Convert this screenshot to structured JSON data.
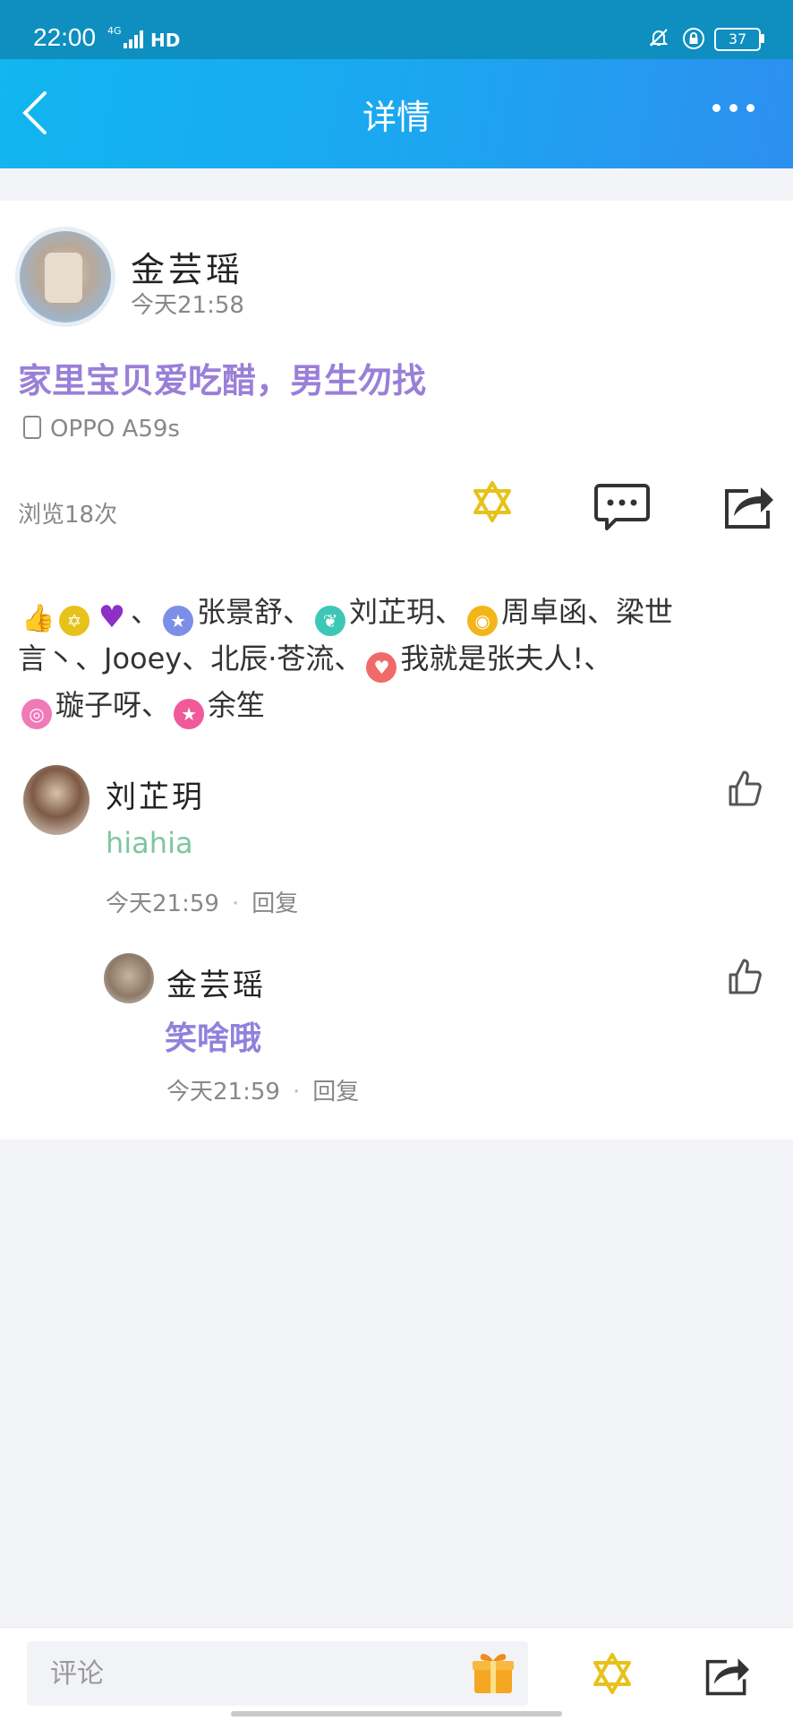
{
  "status_bar": {
    "time": "22:00",
    "network": "4G",
    "hd": "HD",
    "battery": "37"
  },
  "header": {
    "title": "详情"
  },
  "post": {
    "author": "金芸瑶",
    "time": "今天21:58",
    "text": "家里宝贝爱吃醋，男生勿找",
    "device": "OPPO A59s",
    "views": "浏览18次"
  },
  "likes": {
    "line1_names": [
      "张景舒、",
      "刘芷玥、",
      "周卓函、梁世"
    ],
    "line2_text": "言丶、Jooey、北辰·苍流、",
    "line2_name": "我就是张夫人!、",
    "line3_names": [
      "璇子呀",
      "余笙"
    ],
    "line3_sep": "、"
  },
  "comments": [
    {
      "author": "刘芷玥",
      "text": "hiahia",
      "time": "今天21:59",
      "reply_label": "回复"
    },
    {
      "author": "金芸瑶",
      "text": "笑啥哦",
      "time": "今天21:59",
      "reply_label": "回复"
    }
  ],
  "bottom_bar": {
    "comment_placeholder": "评论"
  },
  "colors": {
    "header_blue": "#1ca6f0",
    "post_text_purple": "#9a7fd8",
    "reply_text_purple": "#8f82dc",
    "comment_text_green": "#7fc6a0",
    "star_yellow": "#e6c21a",
    "gift_orange": "#f5a623"
  },
  "icons": {
    "back": "chevron-left-icon",
    "more": "more-dots-icon",
    "star": "star-of-david-icon",
    "comment": "comment-bubble-icon",
    "share": "share-icon",
    "like": "thumbs-up-icon",
    "gift": "gift-icon"
  }
}
